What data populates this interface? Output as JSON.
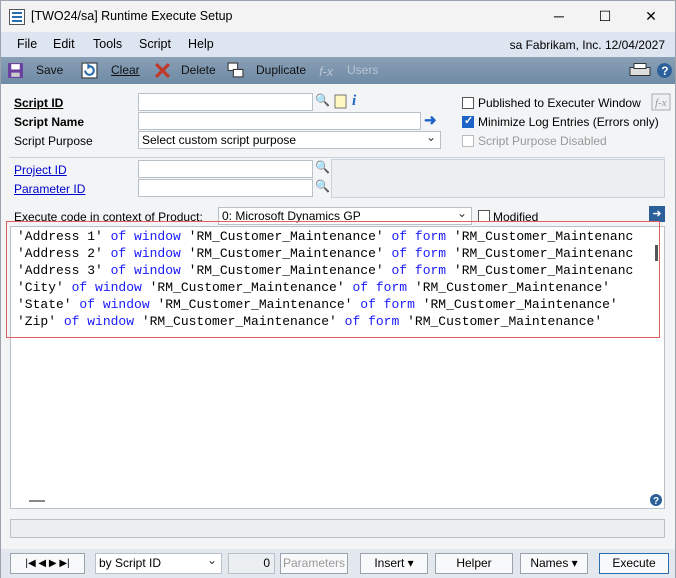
{
  "window": {
    "title": "[TWO24/sa] Runtime Execute Setup",
    "minimize": "─",
    "maximize": "☐",
    "close": "✕"
  },
  "menu": {
    "file": "File",
    "edit": "Edit",
    "tools": "Tools",
    "script": "Script",
    "help": "Help",
    "user_info": "sa  Fabrikam, Inc.  12/04/2027"
  },
  "toolbar": {
    "save": "Save",
    "clear": "Clear",
    "delete": "Delete",
    "duplicate": "Duplicate",
    "users": "Users"
  },
  "form": {
    "script_id_label": "Script ID",
    "script_name_label": "Script Name",
    "script_purpose_label": "Script Purpose",
    "script_id_value": "",
    "script_name_value": "",
    "script_purpose_value": "Select custom script purpose",
    "published_label": "Published to Executer Window",
    "published_checked": false,
    "minimize_log_label": "Minimize Log Entries (Errors only)",
    "minimize_log_checked": true,
    "purpose_disabled_label": "Script Purpose Disabled",
    "project_id_label": "Project ID",
    "parameter_id_label": "Parameter ID",
    "project_id_value": "",
    "parameter_id_value": "",
    "product_label": "Execute code in context of Product:",
    "product_value": "0: Microsoft Dynamics GP",
    "modified_label": "Modified"
  },
  "code": {
    "lines": [
      [
        {
          "t": "'Address 1' ",
          "k": false
        },
        {
          "t": "of window ",
          "k": true
        },
        {
          "t": "'RM_Customer_Maintenance' ",
          "k": false
        },
        {
          "t": "of form ",
          "k": true
        },
        {
          "t": "'RM_Customer_Maintenanc",
          "k": false
        }
      ],
      [
        {
          "t": "'Address 2' ",
          "k": false
        },
        {
          "t": "of window ",
          "k": true
        },
        {
          "t": "'RM_Customer_Maintenance' ",
          "k": false
        },
        {
          "t": "of form ",
          "k": true
        },
        {
          "t": "'RM_Customer_Maintenanc",
          "k": false
        }
      ],
      [
        {
          "t": "'Address 3' ",
          "k": false
        },
        {
          "t": "of window ",
          "k": true
        },
        {
          "t": "'RM_Customer_Maintenance' ",
          "k": false
        },
        {
          "t": "of form ",
          "k": true
        },
        {
          "t": "'RM_Customer_Maintenanc",
          "k": false
        }
      ],
      [
        {
          "t": "'City' ",
          "k": false
        },
        {
          "t": "of window ",
          "k": true
        },
        {
          "t": "'RM_Customer_Maintenance' ",
          "k": false
        },
        {
          "t": "of form ",
          "k": true
        },
        {
          "t": "'RM_Customer_Maintenance'",
          "k": false
        }
      ],
      [
        {
          "t": "'State' ",
          "k": false
        },
        {
          "t": "of window ",
          "k": true
        },
        {
          "t": "'RM_Customer_Maintenance' ",
          "k": false
        },
        {
          "t": "of form ",
          "k": true
        },
        {
          "t": "'RM_Customer_Maintenance'",
          "k": false
        }
      ],
      [
        {
          "t": "'Zip' ",
          "k": false
        },
        {
          "t": "of window ",
          "k": true
        },
        {
          "t": "'RM_Customer_Maintenance' ",
          "k": false
        },
        {
          "t": "of form ",
          "k": true
        },
        {
          "t": "'RM_Customer_Maintenance'",
          "k": false
        }
      ]
    ]
  },
  "bottom": {
    "sort_value": "by Script ID",
    "count": "0",
    "parameters": "Parameters",
    "insert": "Insert",
    "helper": "Helper",
    "names": "Names",
    "execute": "Execute"
  },
  "colors": {
    "keyword": "#1a1aff",
    "highlight_box": "#e06060",
    "toolbar": "#7f97ae"
  }
}
